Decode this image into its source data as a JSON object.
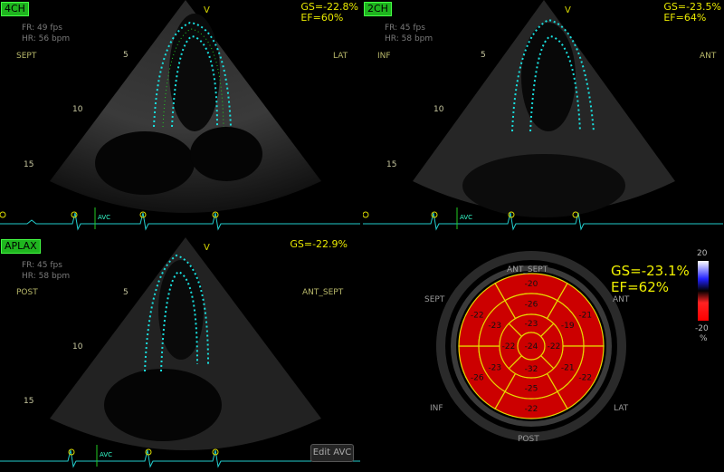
{
  "views": [
    {
      "tag": "4CH",
      "fr": "FR: 49 fps",
      "hr": "HR: 56 bpm",
      "left_label": "SEPT",
      "right_label": "LAT",
      "gs": "GS=-22.8%",
      "ef": "EF=60%",
      "depths": [
        "5",
        "10",
        "15"
      ],
      "v": "V",
      "avc": "AVC"
    },
    {
      "tag": "2CH",
      "fr": "FR: 45 fps",
      "hr": "HR: 58 bpm",
      "left_label": "INF",
      "right_label": "ANT",
      "gs": "GS=-23.5%",
      "ef": "EF=64%",
      "depths": [
        "5",
        "10",
        "15"
      ],
      "v": "V",
      "avc": "AVC"
    },
    {
      "tag": "APLAX",
      "fr": "FR: 45 fps",
      "hr": "HR: 58 bpm",
      "left_label": "POST",
      "right_label": "ANT_SEPT",
      "gs": "GS=-22.9%",
      "ef": "",
      "depths": [
        "5",
        "10",
        "15"
      ],
      "v": "V",
      "avc": "AVC"
    }
  ],
  "bullseye": {
    "labels": {
      "top": "ANT_SEPT",
      "upper_left": "SEPT",
      "upper_right": "ANT",
      "lower_left": "INF",
      "lower_right": "LAT",
      "bottom": "POST"
    },
    "outer": [
      "-20",
      "-21",
      "-22",
      "-22",
      "-26",
      "-22"
    ],
    "mid": [
      "-26",
      "-19",
      "-21",
      "-25",
      "-23",
      "-23"
    ],
    "apical": [
      "-23",
      "-22",
      "-32",
      "-22"
    ],
    "apex": "-24",
    "gs": "GS=-23.1%",
    "ef": "EF=62%",
    "colors": {
      "segment": "#cc0000",
      "line": "#e8d800"
    }
  },
  "scale": {
    "top": "20",
    "bottom": "-20",
    "unit": "%"
  },
  "edit_button": "Edit AVC"
}
